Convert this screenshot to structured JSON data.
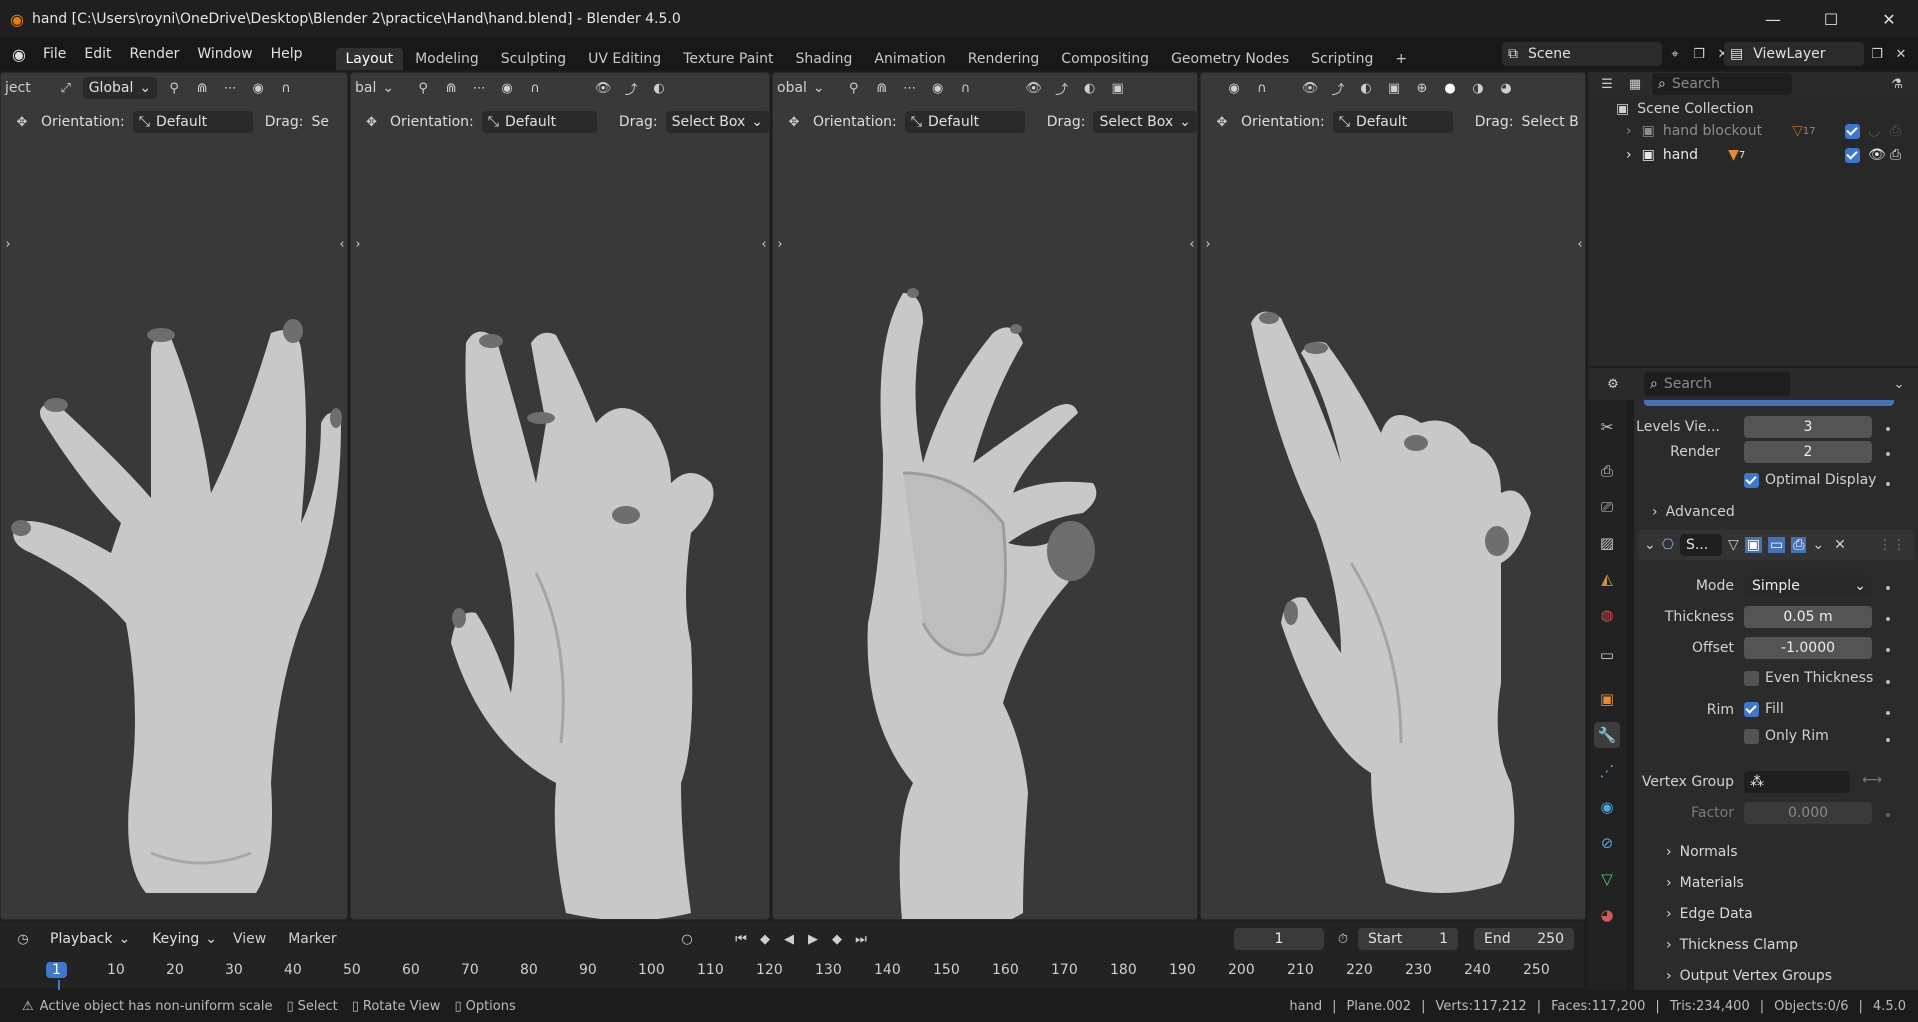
{
  "window": {
    "title": "hand [C:\\Users\\royni\\OneDrive\\Desktop\\Blender 2\\practice\\Hand\\hand.blend] - Blender 4.5.0"
  },
  "menu": [
    "File",
    "Edit",
    "Render",
    "Window",
    "Help"
  ],
  "workspaces": [
    "Layout",
    "Modeling",
    "Sculpting",
    "UV Editing",
    "Texture Paint",
    "Shading",
    "Animation",
    "Rendering",
    "Compositing",
    "Geometry Nodes",
    "Scripting"
  ],
  "active_workspace": "Layout",
  "scene": {
    "label": "Scene",
    "viewlayer": "ViewLayer"
  },
  "viewports": [
    {
      "mode_fragment": "ject",
      "transform": "Global",
      "orientation_label": "Orientation:",
      "orientation": "Default",
      "drag_label": "Drag:",
      "drag": "Se"
    },
    {
      "mode_fragment": "bal",
      "orientation_label": "Orientation:",
      "orientation": "Default",
      "drag_label": "Drag:",
      "drag": "Select Box"
    },
    {
      "mode_fragment": "obal",
      "orientation_label": "Orientation:",
      "orientation": "Default",
      "drag_label": "Drag:",
      "drag": "Select Box"
    },
    {
      "orientation_label": "Orientation:",
      "orientation": "Default",
      "drag_label": "Drag:",
      "drag": "Select B"
    }
  ],
  "outliner": {
    "search_placeholder": "Search",
    "root": "Scene Collection",
    "items": [
      {
        "name": "hand blockout",
        "count": "17"
      },
      {
        "name": "hand",
        "count": "7"
      }
    ]
  },
  "properties": {
    "search_placeholder": "Search",
    "levels_viewport_label": "Levels Vie...",
    "levels_viewport": "3",
    "render_label": "Render",
    "render": "2",
    "optimal_display": "Optimal Display",
    "advanced": "Advanced",
    "modifier_name": "S...",
    "mode_label": "Mode",
    "mode": "Simple",
    "thickness_label": "Thickness",
    "thickness": "0.05 m",
    "offset_label": "Offset",
    "offset": "-1.0000",
    "even_thickness": "Even Thickness",
    "rim_label": "Rim",
    "fill": "Fill",
    "only_rim": "Only Rim",
    "vertex_group_label": "Vertex Group",
    "factor_label": "Factor",
    "factor": "0.000",
    "subpanels": [
      "Normals",
      "Materials",
      "Edge Data",
      "Thickness Clamp",
      "Output Vertex Groups"
    ]
  },
  "timeline": {
    "menus": [
      "Playback",
      "Keying",
      "View",
      "Marker"
    ],
    "current_frame": "1",
    "start_label": "Start",
    "start": "1",
    "end_label": "End",
    "end": "250",
    "ticks": [
      "1",
      "10",
      "20",
      "30",
      "40",
      "50",
      "60",
      "70",
      "80",
      "90",
      "100",
      "110",
      "120",
      "130",
      "140",
      "150",
      "160",
      "170",
      "180",
      "190",
      "200",
      "210",
      "220",
      "230",
      "240",
      "250"
    ]
  },
  "status": {
    "warning": "Active object has non-uniform scale",
    "hints": [
      "Select",
      "Rotate View",
      "Options"
    ],
    "object": "hand",
    "mesh": "Plane.002",
    "verts": "Verts:117,212",
    "faces": "Faces:117,200",
    "tris": "Tris:234,400",
    "objects": "Objects:0/6",
    "version": "4.5.0"
  },
  "colors": {
    "accent": "#4772b3",
    "viewport_bg": "#393939",
    "mesh": "#c8c8c8",
    "nail": "#6e6e6e",
    "playhead": "#3f78c8"
  }
}
